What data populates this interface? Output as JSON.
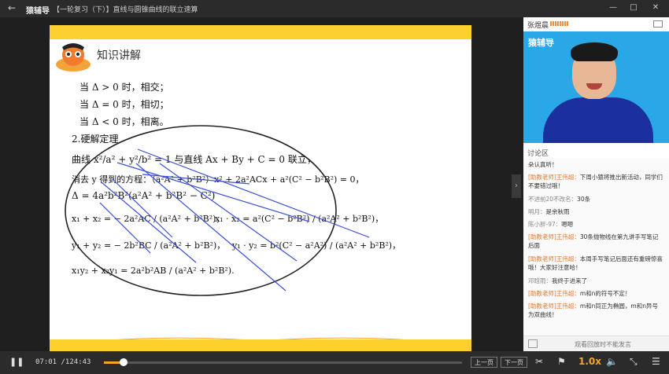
{
  "topbar": {
    "back_icon": "arrow-left-icon",
    "brand": "猿辅导",
    "title": "【一轮复习（下）】直线与圆锥曲线的联立速算",
    "window_controls": [
      "minimize-icon",
      "restore-icon",
      "maximize-icon",
      "close-icon"
    ]
  },
  "slide": {
    "heading": "知识讲解",
    "lines": [
      "当 Δ > 0 时，相交；",
      "当 Δ = 0 时，相切；",
      "当 Δ < 0 时，相离。",
      "2.硬解定理",
      "曲线 x²/a² + y²/b² = 1 与直线 Ax + By + C = 0 联立，",
      "消去 y 得到的方程：（a²A² + b²B²）x² + 2a²ACx + a²(C² − b²B²) = 0，",
      "Δ = 4a²b²B²(a²A² + b²B² − C²)",
      "x₁ + x₂ = − 2a²AC / (a²A² + b²B²)，",
      "x₁ · x₂ = a²(C² − b²B²) / (a²A² + b²B²)，",
      "y₁ + y₂ = − 2b²BC / (a²A² + b²B²)，",
      "y₁ · y₂ = b²(C² − a²A²) / (a²A² + b²B²)，",
      "x₁y₂ + x₂y₁ = 2a²b²AB / (a²A² + b²B²)."
    ]
  },
  "right_panel": {
    "teacher_name": "张煜晨",
    "video_logo": "猿辅导",
    "discussion_title": "讨论区",
    "messages": [
      {
        "who": "",
        "text": "朵认真听！"
      },
      {
        "who": "[助教老师]王伟超：",
        "text": "下周小猿将推出新活动，同学们不要错过哦！"
      },
      {
        "who": "不进前20不改名：",
        "text": "30条"
      },
      {
        "who": "明月：",
        "text": "是余秋雨"
      },
      {
        "who": "陈小胖-97：",
        "text": "嗯嗯"
      },
      {
        "who": "[助教老师]王伟超：",
        "text": "30条抛物线在第九讲手写笔记后面"
      },
      {
        "who": "[助教老师]王伟超：",
        "text": "本周手写笔记后面还有重磅惊喜哦！大家好注意哈！"
      },
      {
        "who": "邓晗雨：",
        "text": "我终于进来了"
      },
      {
        "who": "[助教老师]王伟超：",
        "text": "m和n的符号不定！"
      },
      {
        "who": "[助教老师]王伟超：",
        "text": "m和n同正为椭圆，m和n异号为双曲线！"
      }
    ],
    "bottom_note": "观看回放时不能发言"
  },
  "player": {
    "current_time": "07:01",
    "total_time": "/124:43",
    "progress": 0.056,
    "prev_label": "上一页",
    "next_label": "下一页",
    "speed": "1.0x"
  }
}
